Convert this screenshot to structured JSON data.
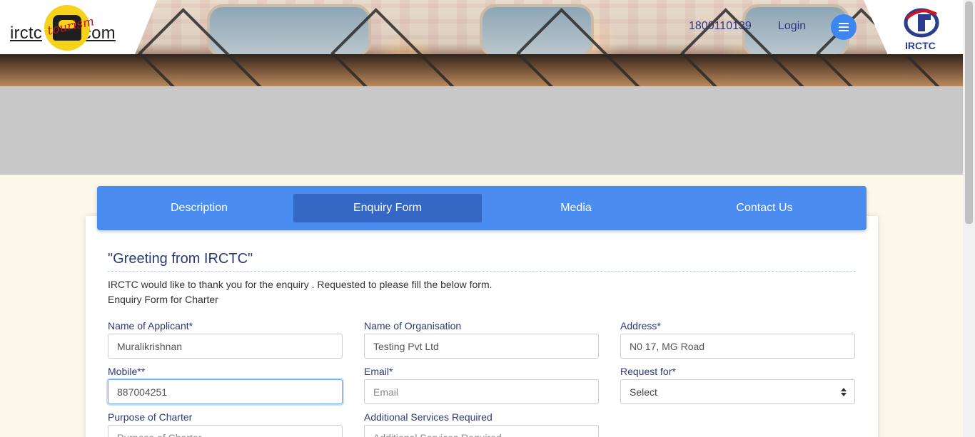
{
  "header": {
    "logo_prefix": "irctc",
    "logo_suffix": ".com",
    "logo_script": "tourism",
    "phone": "1800110139",
    "login_label": "Login",
    "menu_icon": "hamburger-icon",
    "brand_label": "IRCTC"
  },
  "tabs": [
    {
      "label": "Description",
      "active": false
    },
    {
      "label": "Enquiry Form",
      "active": true
    },
    {
      "label": "Media",
      "active": false
    },
    {
      "label": "Contact Us",
      "active": false
    }
  ],
  "content": {
    "title": "\"Greeting from IRCTC\"",
    "intro_line1": "IRCTC would like to thank you for the enquiry . Requested to please fill the below form.",
    "intro_line2": "Enquiry Form for Charter"
  },
  "form": {
    "applicant": {
      "label": "Name of Applicant*",
      "value": "Muralikrishnan",
      "placeholder": "Name of Applicant"
    },
    "organisation": {
      "label": "Name of Organisation",
      "value": "Testing Pvt Ltd",
      "placeholder": "Name of Organisation"
    },
    "address": {
      "label": "Address*",
      "value": "N0 17, MG Road",
      "placeholder": "Address"
    },
    "mobile": {
      "label": "Mobile**",
      "value": "887004251",
      "placeholder": "Mobile"
    },
    "email": {
      "label": "Email*",
      "value": "",
      "placeholder": "Email"
    },
    "request_for": {
      "label": "Request for*",
      "selected": "Select"
    },
    "purpose": {
      "label": "Purpose of Charter",
      "value": "",
      "placeholder": "Purpose of Charter"
    },
    "additional": {
      "label": "Additional Services Required",
      "value": "",
      "placeholder": "Additional Services Required"
    }
  },
  "colors": {
    "tab_bar": "#4a8cf0",
    "tab_active": "#3567c4",
    "label_text": "#2b3a78",
    "menu_button": "#3d86f0"
  }
}
